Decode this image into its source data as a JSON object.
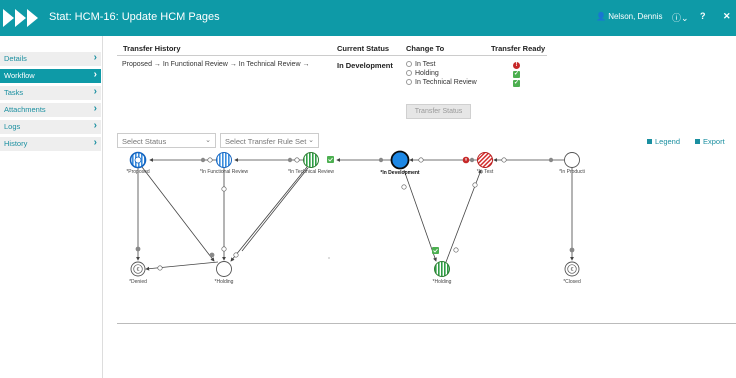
{
  "app": {
    "title": "Stat: HCM-16: Update HCM Pages",
    "user": "Nelson, Dennis",
    "accent": "#0e9aa7"
  },
  "sidebar": {
    "items": [
      {
        "label": "Details",
        "active": false
      },
      {
        "label": "Workflow",
        "active": true
      },
      {
        "label": "Tasks",
        "active": false
      },
      {
        "label": "Attachments",
        "active": false
      },
      {
        "label": "Logs",
        "active": false
      },
      {
        "label": "History",
        "active": false
      }
    ]
  },
  "transfer": {
    "headers": {
      "history": "Transfer History",
      "current": "Current Status",
      "change_to": "Change To",
      "ready": "Transfer Ready"
    },
    "history": [
      "Proposed",
      "In Functional Review",
      "In Technical Review"
    ],
    "history_sep": "→",
    "current_status": "In Development",
    "options": [
      {
        "label": "In Test",
        "ready": false
      },
      {
        "label": "Holding",
        "ready": true
      },
      {
        "label": "In Technical Review",
        "ready": true
      }
    ],
    "button": "Transfer Status"
  },
  "filters": {
    "status": "Select Status",
    "rule_set": "Select Transfer Rule Set"
  },
  "tools": {
    "legend": "Legend",
    "export": "Export"
  },
  "workflow": {
    "nodes": [
      {
        "id": "proposed",
        "label": "*Proposed",
        "style": "blue-ring"
      },
      {
        "id": "functional",
        "label": "*In Functional Review",
        "style": "blue-stripe"
      },
      {
        "id": "technical",
        "label": "*In Technical Review",
        "style": "green-stripe"
      },
      {
        "id": "development",
        "label": "*In Development",
        "style": "current"
      },
      {
        "id": "test",
        "label": "*In Test",
        "style": "red-stripe"
      },
      {
        "id": "production",
        "label": "*In Producti",
        "style": "plain"
      },
      {
        "id": "denied",
        "label": "*Denied",
        "style": "end"
      },
      {
        "id": "holding1",
        "label": "*Holding",
        "style": "plain"
      },
      {
        "id": "holding2",
        "label": "*Holding",
        "style": "green-stripe"
      },
      {
        "id": "closed",
        "label": "*Closed",
        "style": "end"
      }
    ]
  }
}
